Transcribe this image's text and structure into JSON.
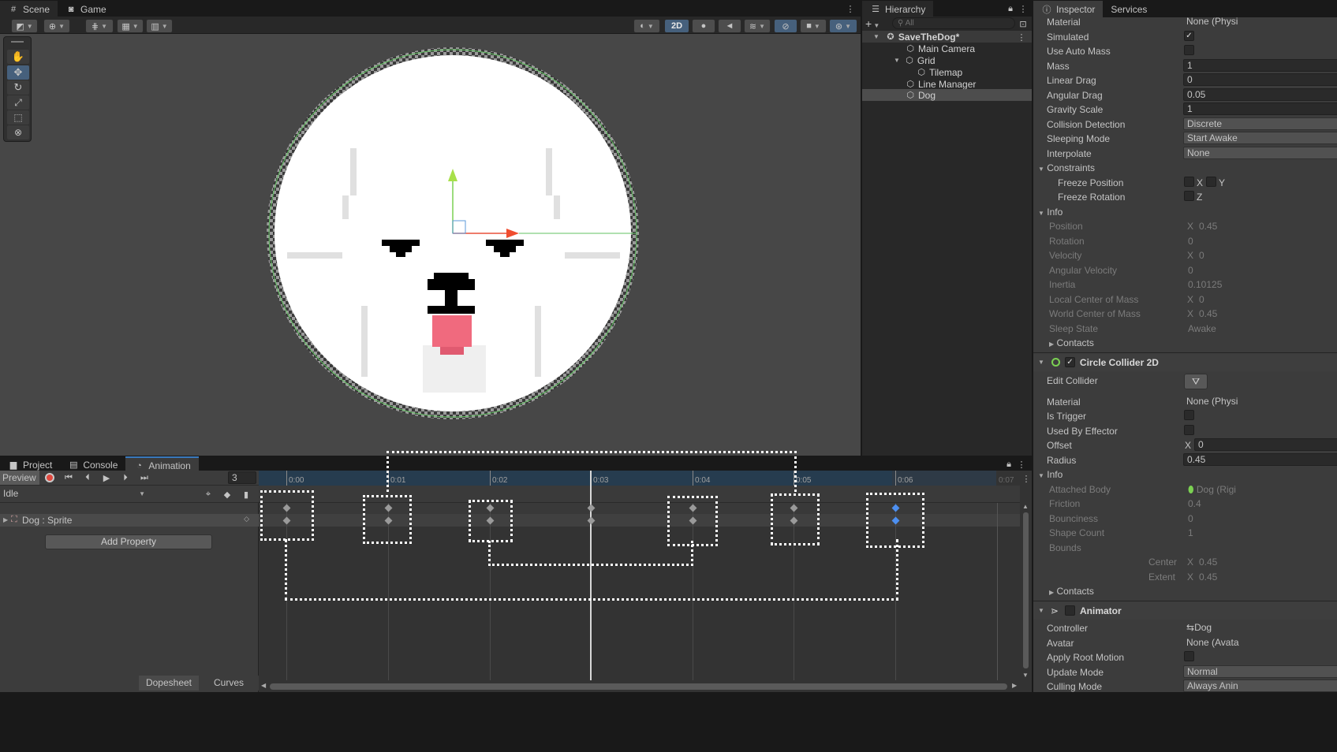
{
  "scene": {
    "tabs": [
      {
        "label": "Scene",
        "icon": "grid-icon"
      },
      {
        "label": "Game",
        "icon": "gamepad-icon"
      }
    ],
    "toolbar_2d": "2D"
  },
  "hierarchy": {
    "tab": "Hierarchy",
    "search_placeholder": "All",
    "items": [
      {
        "label": "SaveTheDog*",
        "depth": 0,
        "root": true
      },
      {
        "label": "Main Camera",
        "depth": 1
      },
      {
        "label": "Grid",
        "depth": 1
      },
      {
        "label": "Tilemap",
        "depth": 2
      },
      {
        "label": "Line Manager",
        "depth": 1
      },
      {
        "label": "Dog",
        "depth": 1,
        "selected": true
      }
    ]
  },
  "inspector": {
    "tabs": [
      "Inspector",
      "Services"
    ],
    "rigidbody": {
      "material_label": "Material",
      "material_value": "None (Physi",
      "simulated_label": "Simulated",
      "auto_mass_label": "Use Auto Mass",
      "mass_label": "Mass",
      "mass_value": "1",
      "linear_drag_label": "Linear Drag",
      "linear_drag_value": "0",
      "angular_drag_label": "Angular Drag",
      "angular_drag_value": "0.05",
      "gravity_label": "Gravity Scale",
      "gravity_value": "1",
      "collision_label": "Collision Detection",
      "collision_value": "Discrete",
      "sleeping_label": "Sleeping Mode",
      "sleeping_value": "Start Awake",
      "interpolate_label": "Interpolate",
      "interpolate_value": "None",
      "constraints_label": "Constraints",
      "freeze_pos_label": "Freeze Position",
      "x": "X",
      "y": "Y",
      "freeze_rot_label": "Freeze Rotation",
      "z": "Z",
      "info_label": "Info",
      "info": [
        {
          "label": "Position",
          "axis": "X",
          "value": "0.45"
        },
        {
          "label": "Rotation",
          "axis": "",
          "value": "0"
        },
        {
          "label": "Velocity",
          "axis": "X",
          "value": "0"
        },
        {
          "label": "Angular Velocity",
          "axis": "",
          "value": "0"
        },
        {
          "label": "Inertia",
          "axis": "",
          "value": "0.10125"
        },
        {
          "label": "Local Center of Mass",
          "axis": "X",
          "value": "0"
        },
        {
          "label": "World Center of Mass",
          "axis": "X",
          "value": "0.45"
        },
        {
          "label": "Sleep State",
          "axis": "",
          "value": "Awake"
        }
      ],
      "contacts_label": "Contacts"
    },
    "collider": {
      "title": "Circle Collider 2D",
      "edit_label": "Edit Collider",
      "material_label": "Material",
      "material_value": "None (Physi",
      "trigger_label": "Is Trigger",
      "effector_label": "Used By Effector",
      "offset_label": "Offset",
      "offset_axis": "X",
      "offset_value": "0",
      "radius_label": "Radius",
      "radius_value": "0.45",
      "info_label": "Info",
      "info": [
        {
          "label": "Attached Body",
          "value": "Dog (Rigi"
        },
        {
          "label": "Friction",
          "value": "0.4"
        },
        {
          "label": "Bounciness",
          "value": "0"
        },
        {
          "label": "Shape Count",
          "value": "1"
        }
      ],
      "bounds_label": "Bounds",
      "center_label": "Center",
      "center_axis": "X",
      "center_value": "0.45",
      "extent_label": "Extent",
      "extent_axis": "X",
      "extent_value": "0.45",
      "contacts_label": "Contacts"
    },
    "animator": {
      "title": "Animator",
      "controller_label": "Controller",
      "controller_value": "Dog",
      "avatar_label": "Avatar",
      "avatar_value": "None (Avata",
      "root_motion_label": "Apply Root Motion",
      "update_label": "Update Mode",
      "update_value": "Normal",
      "culling_label": "Culling Mode",
      "culling_value": "Always Anin"
    }
  },
  "bottom": {
    "tabs": [
      {
        "label": "Project",
        "icon": "folder-icon"
      },
      {
        "label": "Console",
        "icon": "console-icon"
      },
      {
        "label": "Animation",
        "icon": "animation-icon"
      }
    ],
    "preview_label": "Preview",
    "frame_value": "3",
    "clip_value": "Idle",
    "property_label": "Dog : Sprite",
    "add_property": "Add Property",
    "dopesheet": "Dopesheet",
    "curves": "Curves",
    "timeline": [
      "0:00",
      "0:01",
      "0:02",
      "0:03",
      "0:04",
      "0:05",
      "0:06",
      "0:07"
    ]
  }
}
